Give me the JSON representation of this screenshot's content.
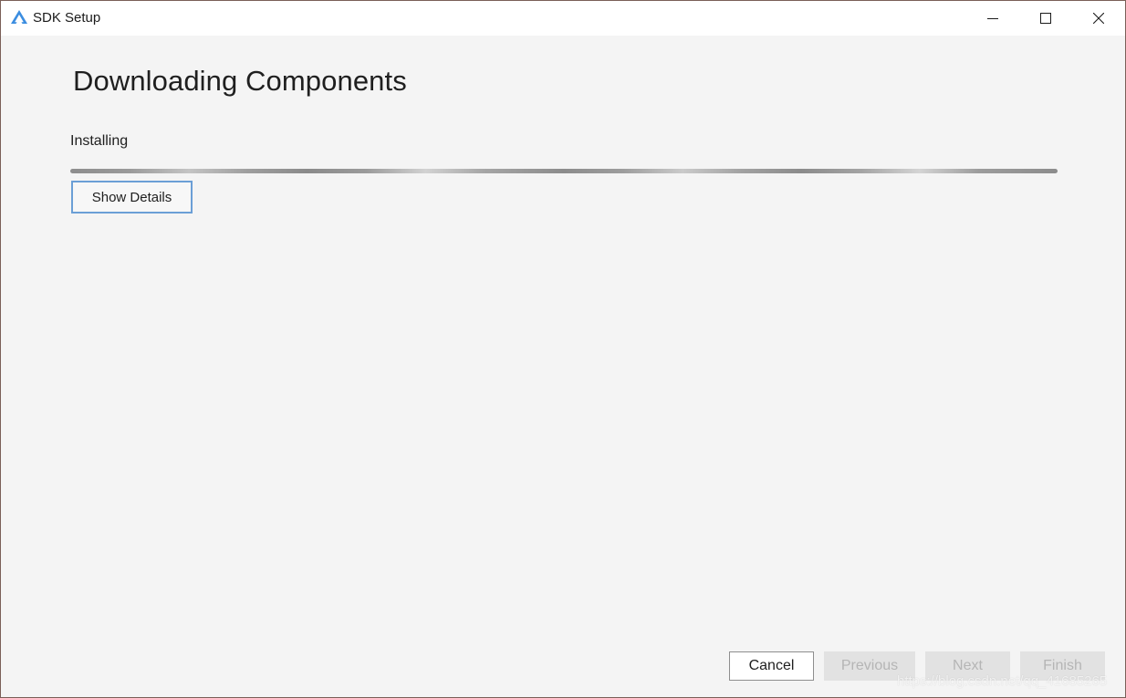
{
  "window": {
    "title": "SDK Setup",
    "app_icon": "app-logo-icon",
    "controls": {
      "minimize_icon": "minimize-icon",
      "maximize_icon": "maximize-icon",
      "close_icon": "close-icon"
    }
  },
  "main": {
    "title": "Downloading Components",
    "status": "Installing",
    "progress": {
      "state": "indeterminate"
    },
    "show_details_label": "Show Details"
  },
  "footer": {
    "cancel_label": "Cancel",
    "previous_label": "Previous",
    "next_label": "Next",
    "finish_label": "Finish"
  },
  "overlay": {
    "watermark": "https://blog.csdn.net/qq_41685265"
  },
  "colors": {
    "window_bg": "#f4f4f4",
    "titlebar_bg": "#ffffff",
    "accent": "#6b9fd6",
    "app_icon": "#3b8de0",
    "disabled_button_bg": "#e2e2e2",
    "disabled_button_text": "#b5b5b5"
  }
}
